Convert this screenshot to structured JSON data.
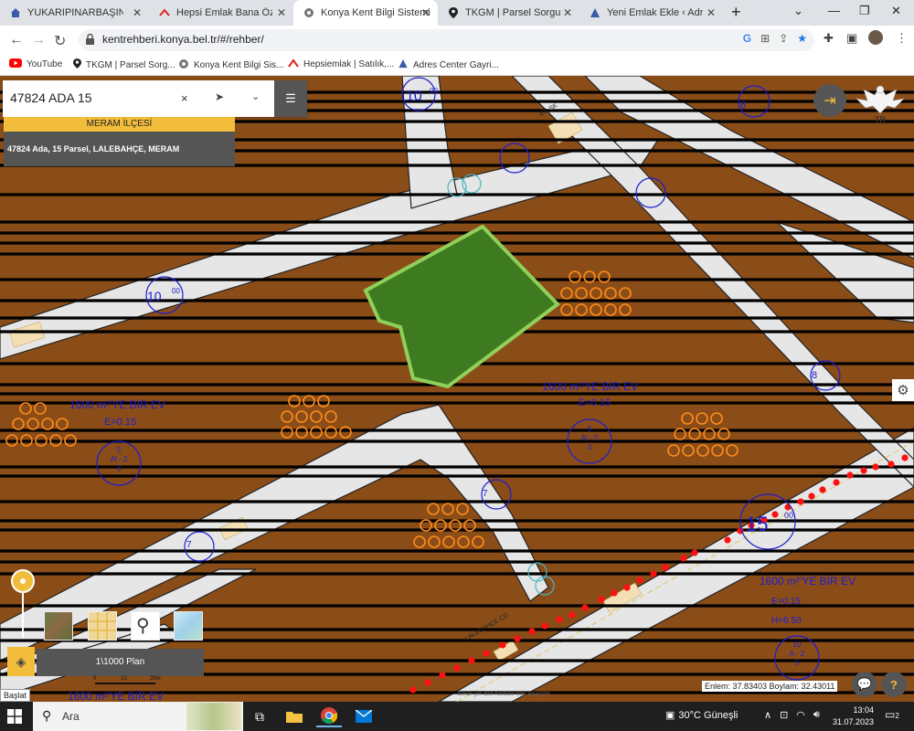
{
  "tabs": [
    {
      "title": "YUKARIPINARBAŞINDA K",
      "icon": "house-icon",
      "active": false
    },
    {
      "title": "Hepsi Emlak Bana Özel",
      "icon": "hepsiemlak-icon",
      "active": false
    },
    {
      "title": "Konya Kent Bilgi Sistemi",
      "icon": "konya-icon",
      "active": true
    },
    {
      "title": "TKGM | Parsel Sorgu Uygu",
      "icon": "map-pin-icon",
      "active": false
    },
    {
      "title": "Yeni Emlak Ekle ‹ Adres Ce",
      "icon": "adres-center-icon",
      "active": false
    }
  ],
  "new_tab": "+",
  "address": {
    "url": "kentrehberi.konya.bel.tr/#/rehber/"
  },
  "bookmarks": [
    {
      "label": "YouTube",
      "icon": "youtube-icon",
      "color": "#ff0000"
    },
    {
      "label": "TKGM | Parsel Sorg...",
      "icon": "map-pin-icon",
      "color": "#222222"
    },
    {
      "label": "Konya Kent Bilgi Sis...",
      "icon": "konya-icon",
      "color": "#444444"
    },
    {
      "label": "Hepsiemlak | Satılık,...",
      "icon": "hepsiemlak-icon",
      "color": "#e0241f"
    },
    {
      "label": "Adres Center Gayri...",
      "icon": "adres-center-icon",
      "color": "#3a5ba9"
    }
  ],
  "search": {
    "value": "47824 ADA 15",
    "clear": "×"
  },
  "district": "MERAM İLÇESİ",
  "result": "47824 Ada, 15 Parsel, LALEBAHÇE, MERAM",
  "map_labels": {
    "block_10_top": "10",
    "block_10_left": "10",
    "block_15": "15",
    "road_00_a": "00",
    "road_00_b": "00",
    "road_00_c": "00",
    "block_8_top": "8",
    "block_8_right": "8",
    "block_7_a": "7",
    "block_7_b": "7",
    "street_1": "ER SK",
    "street_2": "LALEBAHÇE CD",
    "zone_text_1": "1600 m²'YE BİR EV",
    "zone_ratio_1": "E=0.15",
    "zone_text_2": "1600 m²'YE BİR EV",
    "zone_ratio_2": "E=0.15",
    "zone_text_3": "1600 m²'YE BİR EV",
    "zone_ratio_3": "E=0.15",
    "zone_height_3": "H=6.50",
    "zone_text_4": "1600 m²'YE BİR EV",
    "plan_code_1": [
      "5",
      "Al - 2",
      "3"
    ],
    "plan_code_2": [
      "5",
      "Al - 2",
      "3"
    ],
    "plan_code_3": [
      "10",
      "A - 2",
      "5"
    ],
    "tr_label": "TR"
  },
  "colors": {
    "map_background": "#8b4d18",
    "road": "#e6e6e6",
    "parcel_fill": "#3e7a1f",
    "parcel_stroke": "#8fd05a",
    "tree": "#ff8c1a",
    "plan_label": "#1c1ccf",
    "accent": "#f2bd3a"
  },
  "plan_label": "1\\1000 Plan",
  "scale_labels": [
    "0",
    "10",
    "20m"
  ],
  "coordinates": "Enlem: 37.83403 Boylam: 32.43011",
  "attribution": "Sitede yer alan haritalar bilgi amaçlıdır.",
  "baslat": "Başlat",
  "taskbar": {
    "search_placeholder": "Ara",
    "weather": "30°C  Güneşli",
    "time": "13:04",
    "date": "31.07.2023",
    "notifications": "2"
  }
}
